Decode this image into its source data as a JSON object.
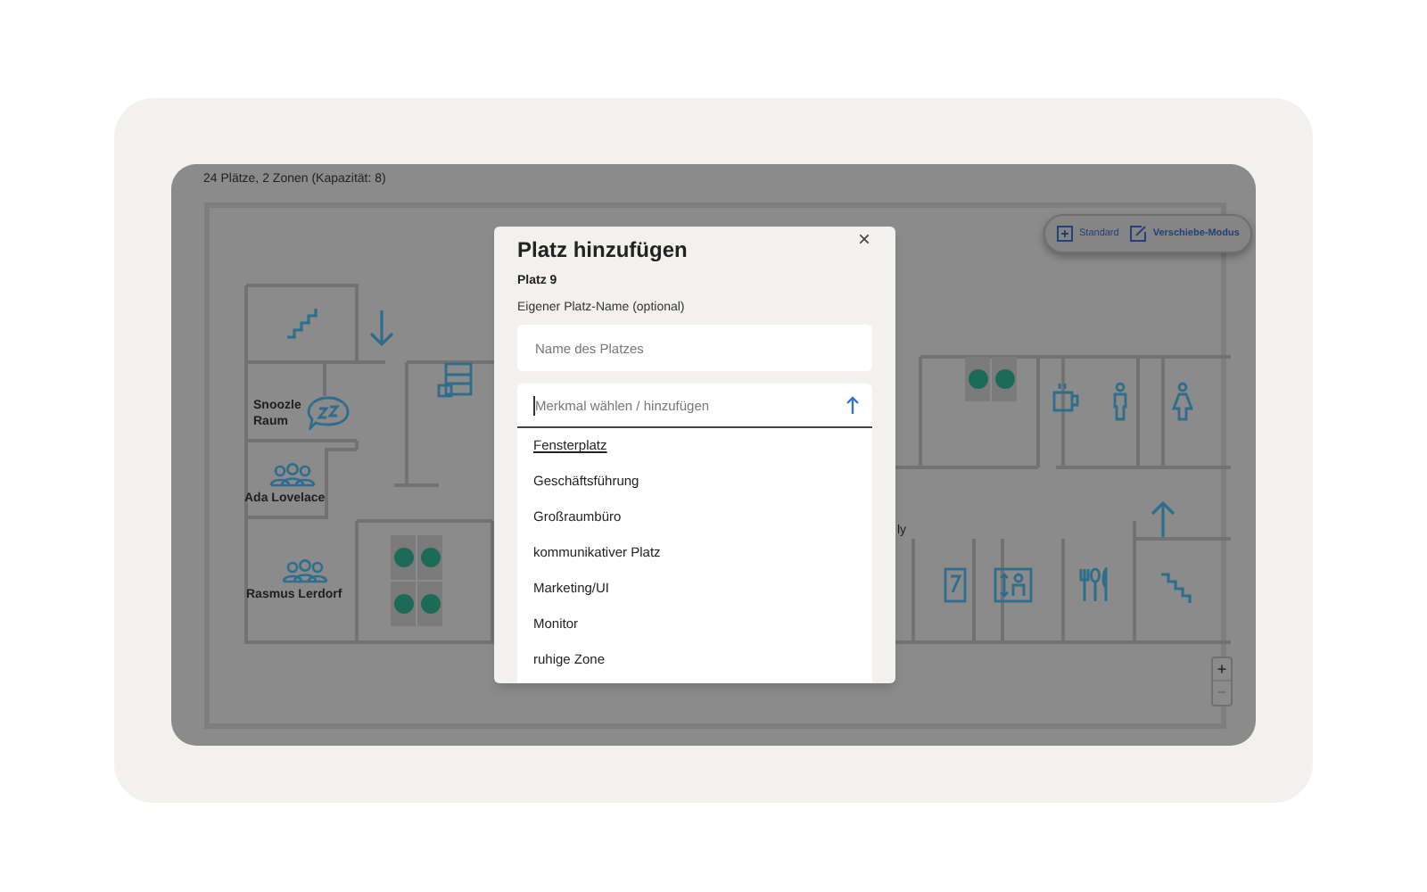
{
  "header": {
    "summary": "24 Plätze, 2 Zonen (Kapazität: 8)"
  },
  "toolbar": [
    {
      "label": "Standard",
      "selected": false
    },
    {
      "label": "Verschiebe-Modus",
      "selected": true
    }
  ],
  "rooms": [
    {
      "label": "Snoozle Raum"
    },
    {
      "label": "Ada Lovelace"
    },
    {
      "label": "Rasmus Lerdorf"
    },
    {
      "label": "ly"
    }
  ],
  "zoom_controls": [
    "+",
    "−"
  ],
  "dialog": {
    "title": "Platz hinzufügen",
    "close": "×",
    "seat": "Platz 9",
    "name_label": "Eigener Platz-Name (optional)",
    "name_field": {
      "placeholder": "Name des Platzes"
    },
    "feature_field": {
      "placeholder": "Merkmal wählen / hinzufügen"
    },
    "options": [
      {
        "label": "Fensterplatz",
        "selected": true
      },
      {
        "label": "Geschäftsführung",
        "selected": false
      },
      {
        "label": "Großraumbüro",
        "selected": false
      },
      {
        "label": "kommunikativer Platz",
        "selected": false
      },
      {
        "label": "Marketing/UI",
        "selected": false
      },
      {
        "label": "Monitor",
        "selected": false
      },
      {
        "label": "ruhige Zone",
        "selected": false
      }
    ]
  }
}
